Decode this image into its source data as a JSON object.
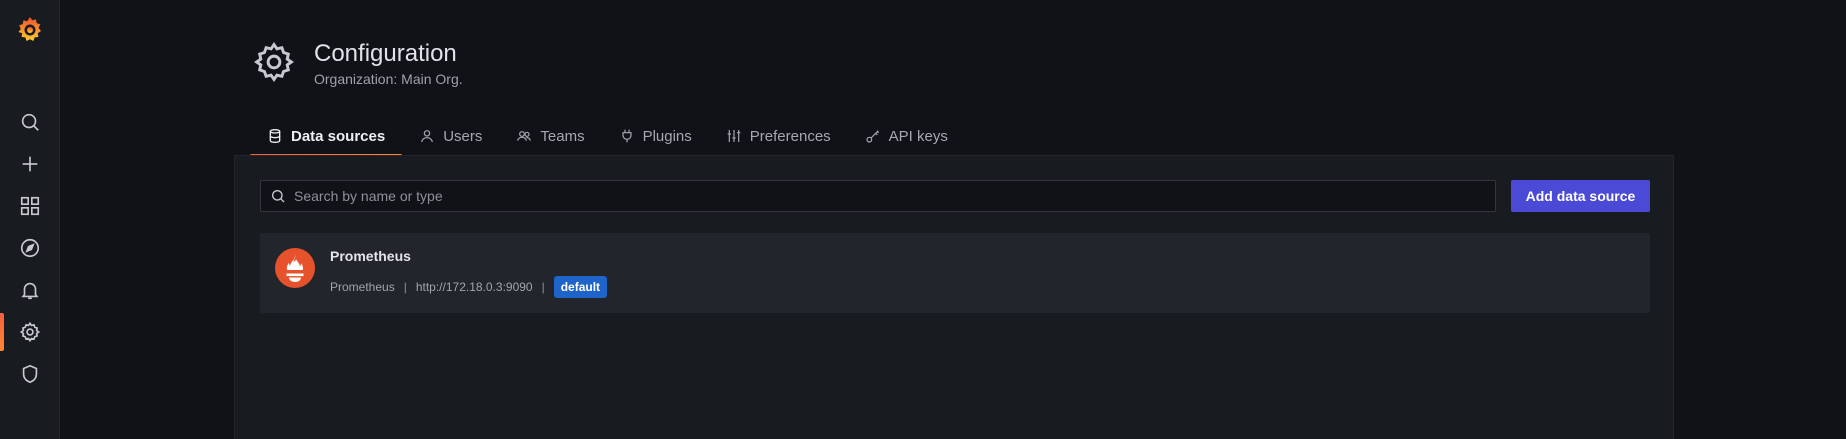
{
  "sidebar": {
    "logo": "grafana-logo-icon",
    "items": [
      {
        "name": "search",
        "icon": "search-icon"
      },
      {
        "name": "create",
        "icon": "plus-icon"
      },
      {
        "name": "dashboards",
        "icon": "apps-grid-icon"
      },
      {
        "name": "explore",
        "icon": "compass-icon"
      },
      {
        "name": "alerting",
        "icon": "bell-icon"
      },
      {
        "name": "configuration",
        "icon": "gear-icon",
        "active": true
      },
      {
        "name": "server-admin",
        "icon": "shield-icon"
      }
    ]
  },
  "header": {
    "icon": "gear-icon",
    "title": "Configuration",
    "subtitle": "Organization: Main Org."
  },
  "tabs": [
    {
      "label": "Data sources",
      "icon": "database-icon",
      "active": true
    },
    {
      "label": "Users",
      "icon": "user-icon"
    },
    {
      "label": "Teams",
      "icon": "users-icon"
    },
    {
      "label": "Plugins",
      "icon": "plug-icon"
    },
    {
      "label": "Preferences",
      "icon": "sliders-icon"
    },
    {
      "label": "API keys",
      "icon": "key-icon"
    }
  ],
  "search": {
    "placeholder": "Search by name or type",
    "value": ""
  },
  "actions": {
    "add_label": "Add data source"
  },
  "datasources": [
    {
      "name": "Prometheus",
      "type": "Prometheus",
      "url": "http://172.18.0.3:9090",
      "badge": "default",
      "icon": "prometheus-icon"
    }
  ],
  "meta_separator": "|",
  "colors": {
    "accent_gradient": [
      "#f55f3e",
      "#ff8833"
    ],
    "primary_button": "#4a4ad6",
    "badge": "#1f64c8",
    "background": "#111217",
    "panel": "#181b1f",
    "card": "#22252b"
  }
}
